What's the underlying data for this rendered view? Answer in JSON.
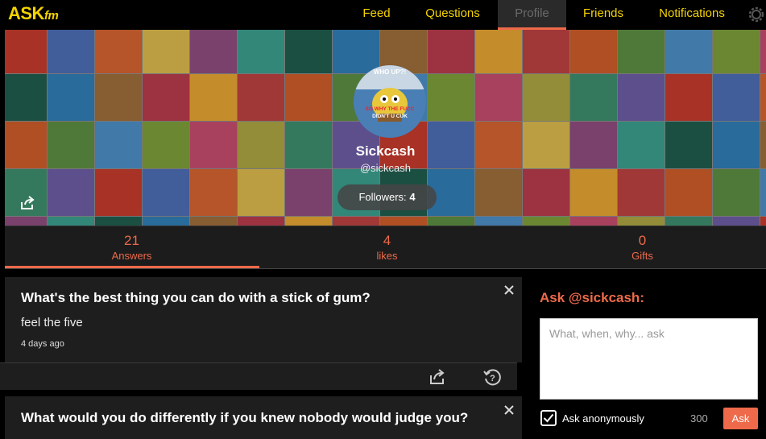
{
  "app": {
    "logo_main": "ASK",
    "logo_sub": "fm"
  },
  "nav": {
    "items": [
      {
        "label": "Feed",
        "active": false
      },
      {
        "label": "Questions",
        "active": false
      },
      {
        "label": "Profile",
        "active": true
      },
      {
        "label": "Friends",
        "active": false
      },
      {
        "label": "Notifications",
        "active": false
      }
    ],
    "settings_icon": "gear-icon"
  },
  "profile": {
    "avatar_text_top": "WHO UP?!",
    "avatar_text_mid": "SO WHY THE FUCC",
    "avatar_text_low": "DIDN'T U CUK",
    "name": "Sickcash",
    "handle": "@sickcash",
    "followers_label": "Followers:",
    "followers_count": "4",
    "share_icon": "share-icon"
  },
  "stats": [
    {
      "value": "21",
      "label": "Answers",
      "selected": true
    },
    {
      "value": "4",
      "label": "likes",
      "selected": false
    },
    {
      "value": "0",
      "label": "Gifts",
      "selected": false
    }
  ],
  "questions": [
    {
      "question": "What's the best thing you can do with a stick of gum?",
      "answer": "feel the five",
      "time": "4 days ago"
    },
    {
      "question": "What would you do differently if you knew nobody would judge you?",
      "answer": "",
      "time": ""
    }
  ],
  "ask": {
    "title": "Ask @sickcash:",
    "placeholder": "What, when, why... ask",
    "anonymous_label": "Ask anonymously",
    "anonymous_checked": true,
    "char_count": "300",
    "button_label": "Ask"
  },
  "colors": {
    "accent": "#ee6a4a",
    "brand_yellow": "#f5d400",
    "background": "#000000",
    "card": "#1e1e1e"
  }
}
